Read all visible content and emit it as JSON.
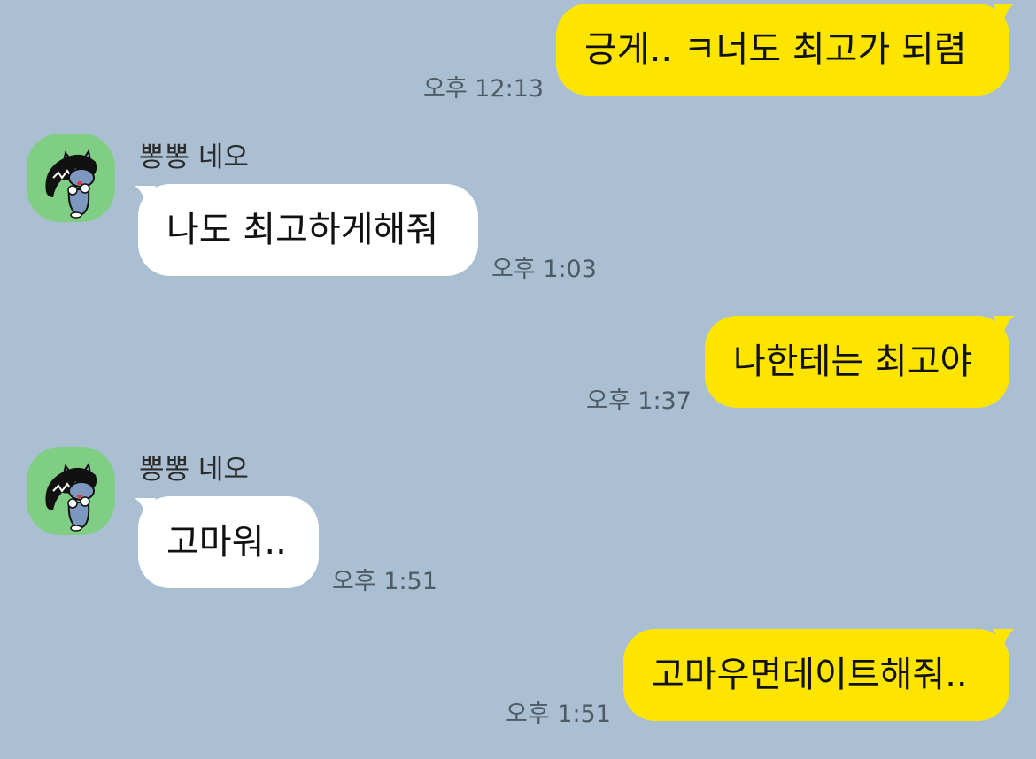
{
  "chat": {
    "messages": [
      {
        "id": "m1",
        "side": "mine",
        "text": "긍게.. ㅋ너도 최고가 되렴",
        "time": "오후 12:13"
      },
      {
        "id": "m2",
        "side": "theirs",
        "sender": "뽕뽕 네오",
        "text": "나도 최고하게해줘",
        "time": "오후 1:03"
      },
      {
        "id": "m3",
        "side": "mine",
        "text": "나한테는 최고야",
        "time": "오후 1:37"
      },
      {
        "id": "m4",
        "side": "theirs",
        "sender": "뽕뽕 네오",
        "text": "고마워..",
        "time": "오후 1:51"
      },
      {
        "id": "m5",
        "side": "mine",
        "text": "고마우면데이트해줘..",
        "time": "오후 1:51"
      }
    ],
    "avatar_icon": "neo-cat-avatar-icon",
    "colors": {
      "background": "#aabfd1",
      "my_bubble": "#fee500",
      "their_bubble": "#ffffff",
      "avatar_bg": "#7fce83"
    }
  }
}
